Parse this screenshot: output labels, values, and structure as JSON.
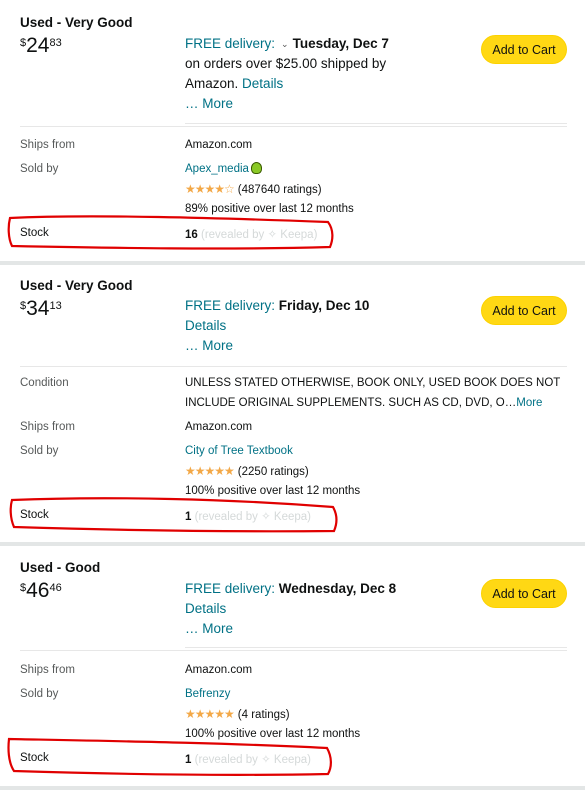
{
  "offers": [
    {
      "condition": "Used - Very Good",
      "price": {
        "symbol": "$",
        "whole": "24",
        "fraction": "83"
      },
      "delivery": {
        "free_label": "FREE delivery:",
        "date": "Tuesday, Dec 7",
        "line2": "on orders over $25.00 shipped by",
        "line3": "Amazon.",
        "details": "Details",
        "more": "… More"
      },
      "add_to_cart": "Add to Cart",
      "ships_from_label": "Ships from",
      "ships_from": "Amazon.com",
      "sold_by_label": "Sold by",
      "seller": "Apex_media",
      "stars": "★★★★☆",
      "ratings": "(487640 ratings)",
      "positive": "89% positive over last 12 months",
      "stock_label": "Stock",
      "stock": "16",
      "stock_note": "(revealed by ✧ Keepa)"
    },
    {
      "condition": "Used - Very Good",
      "price": {
        "symbol": "$",
        "whole": "34",
        "fraction": "13"
      },
      "delivery": {
        "free_label": "FREE delivery:",
        "date": "Friday, Dec 10",
        "details": "Details",
        "more": "… More"
      },
      "add_to_cart": "Add to Cart",
      "condition_label": "Condition",
      "condition_line1": "UNLESS STATED OTHERWISE, BOOK ONLY, USED BOOK DOES NOT",
      "condition_line2": "INCLUDE ORIGINAL SUPPLEMENTS. SUCH AS CD, DVD, O…",
      "condition_more": "More",
      "ships_from_label": "Ships from",
      "ships_from": "Amazon.com",
      "sold_by_label": "Sold by",
      "seller": "City of Tree Textbook",
      "stars": "★★★★★",
      "ratings": "(2250 ratings)",
      "positive": "100% positive over last 12 months",
      "stock_label": "Stock",
      "stock": "1",
      "stock_note": "(revealed by ✧ Keepa)"
    },
    {
      "condition": "Used - Good",
      "price": {
        "symbol": "$",
        "whole": "46",
        "fraction": "46"
      },
      "delivery": {
        "free_label": "FREE delivery:",
        "date": "Wednesday, Dec 8",
        "details": "Details",
        "more": "… More"
      },
      "add_to_cart": "Add to Cart",
      "ships_from_label": "Ships from",
      "ships_from": "Amazon.com",
      "sold_by_label": "Sold by",
      "seller": "Befrenzy",
      "stars": "★★★★★",
      "ratings": "(4 ratings)",
      "positive": "100% positive over last 12 months",
      "stock_label": "Stock",
      "stock": "1",
      "stock_note": "(revealed by ✧ Keepa)"
    }
  ],
  "colors": {
    "accent_link": "#007185",
    "button": "#ffd814",
    "stars": "#f3a847",
    "annotation": "#e00000"
  }
}
